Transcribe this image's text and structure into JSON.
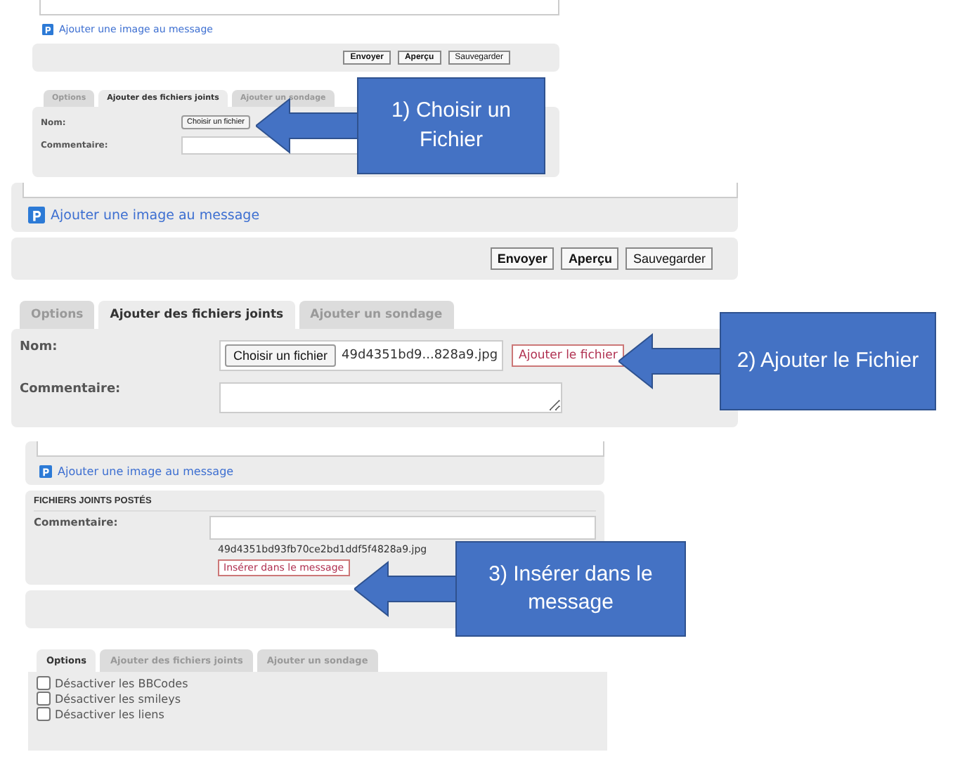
{
  "screenshot_1": {
    "image_link": "Ajouter une image au message",
    "buttons": [
      {
        "label": "Envoyer",
        "bold": true
      },
      {
        "label": "Aperçu",
        "bold": true
      },
      {
        "label": "Sauvegarder",
        "bold": false
      }
    ],
    "tabs": [
      {
        "label": "Options",
        "selected": false
      },
      {
        "label": "Ajouter des fichiers joints",
        "selected": true
      },
      {
        "label": "Ajouter un sondage",
        "selected": false
      }
    ],
    "name_label": "Nom:",
    "file_button": "Choisir un fichier",
    "comment_label": "Commentaire:"
  },
  "screenshot_2": {
    "image_link": "Ajouter une image au message",
    "buttons": [
      {
        "label": "Envoyer",
        "bold": true
      },
      {
        "label": "Aperçu",
        "bold": true
      },
      {
        "label": "Sauvegarder",
        "bold": false
      }
    ],
    "tabs": [
      {
        "label": "Options",
        "selected": false
      },
      {
        "label": "Ajouter des fichiers joints",
        "selected": true
      },
      {
        "label": "Ajouter un sondage",
        "selected": false
      }
    ],
    "name_label": "Nom:",
    "file_button": "Choisir un fichier",
    "file_name": "49d4351bd9...828a9.jpg",
    "add_button": "Ajouter le fichier",
    "comment_label": "Commentaire:"
  },
  "screenshot_3": {
    "image_link": "Ajouter une image au message",
    "section_title": "FICHIERS JOINTS POSTÉS",
    "comment_label": "Commentaire:",
    "file_name": "49d4351bd93fb70ce2bd1ddf5f4828a9.jpg",
    "insert_button": "Insérer dans le message"
  },
  "screenshot_4": {
    "tabs": [
      {
        "label": "Options",
        "selected": true
      },
      {
        "label": "Ajouter des fichiers joints",
        "selected": false
      },
      {
        "label": "Ajouter un sondage",
        "selected": false
      }
    ],
    "options": [
      {
        "label": "Désactiver les BBCodes",
        "checked": false
      },
      {
        "label": "Désactiver les smileys",
        "checked": false
      },
      {
        "label": "Désactiver les liens",
        "checked": false
      }
    ]
  },
  "callouts": [
    {
      "text": "1) Choisir un Fichier"
    },
    {
      "text": "2) Ajouter le Fichier"
    },
    {
      "text": "3) Insérer dans le message"
    }
  ]
}
